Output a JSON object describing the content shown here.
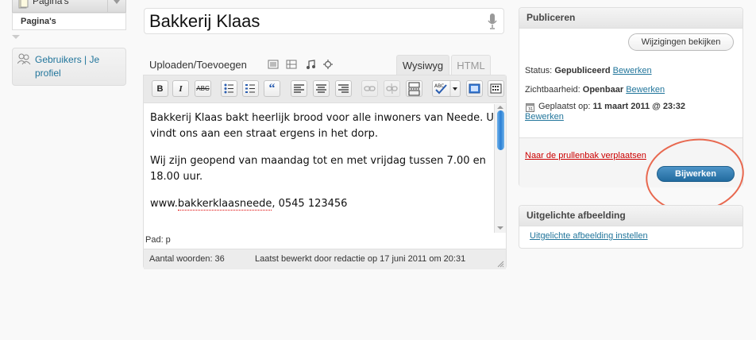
{
  "sidebar": {
    "menu_top_label": "Pagina's",
    "submenu_label": "Pagina's",
    "users_label": "Gebruikers | Je profiel"
  },
  "editor": {
    "title": "Bakkerij Klaas",
    "upload_label": "Uploaden/Toevoegen",
    "tab_visual": "Wysiwyg",
    "tab_html": "HTML",
    "toolbar": {
      "bold": "B",
      "italic": "I",
      "strike": "ABC",
      "quote": "“"
    },
    "paragraph1": "Bakkerij Klaas bakt heerlijk brood voor alle inwoners van Neede. U vindt ons aan een straat ergens in het dorp.",
    "paragraph2": "Wij zijn geopend van maandag tot en met vrijdag tussen 7.00 en 18.00 uur.",
    "paragraph3_prefix": "www.",
    "paragraph3_spell": "bakkerklaasneede",
    "paragraph3_suffix": ", 0545 123456",
    "path": "Pad: p",
    "word_count": "Aantal woorden: 36",
    "last_edited": "Laatst bewerkt door redactie op 17 juni 2011 om 20:31"
  },
  "publish": {
    "title": "Publiceren",
    "preview_button": "Wijzigingen bekijken",
    "status_label": "Status:",
    "status_value": "Gepubliceerd",
    "edit_link": "Bewerken",
    "visibility_label": "Zichtbaarheid:",
    "visibility_value": "Openbaar",
    "published_label": "Geplaatst op:",
    "published_value": "11 maart 2011 @ 23:32",
    "trash_link": "Naar de prullenbak verplaatsen",
    "update_button": "Bijwerken"
  },
  "featured": {
    "title": "Uitgelichte afbeelding",
    "link": "Uitgelichte afbeelding instellen"
  },
  "colors": {
    "link": "#21759b",
    "trash": "#cc0000",
    "primary_button": "#226b9f",
    "annotation_circle": "#e8684f"
  }
}
